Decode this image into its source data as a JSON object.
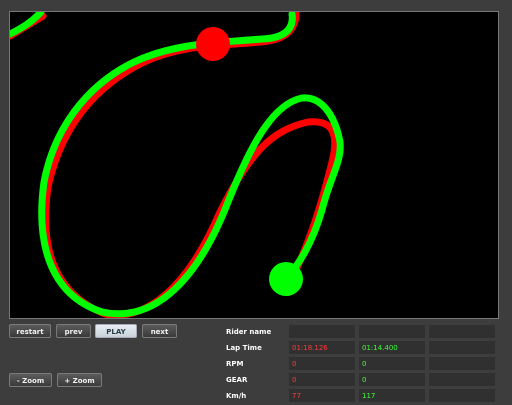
{
  "controls": {
    "restart": "restart",
    "prev": "prev",
    "play": "PLAY",
    "next": "next",
    "zoom_out": "- Zoom",
    "zoom_in": "+ Zoom"
  },
  "telemetry": {
    "rows": [
      {
        "label": "Rider name",
        "red": "",
        "green": ""
      },
      {
        "label": "Lap Time",
        "red": "01:18.126",
        "green": "01:14.400"
      },
      {
        "label": "RPM",
        "red": "0",
        "green": "0"
      },
      {
        "label": "GEAR",
        "red": "0",
        "green": "0"
      },
      {
        "label": "Km/h",
        "red": "77",
        "green": "117"
      }
    ]
  },
  "colors": {
    "rider_red": "#ff0000",
    "rider_green": "#00ff00",
    "canvas_bg": "#000000"
  }
}
